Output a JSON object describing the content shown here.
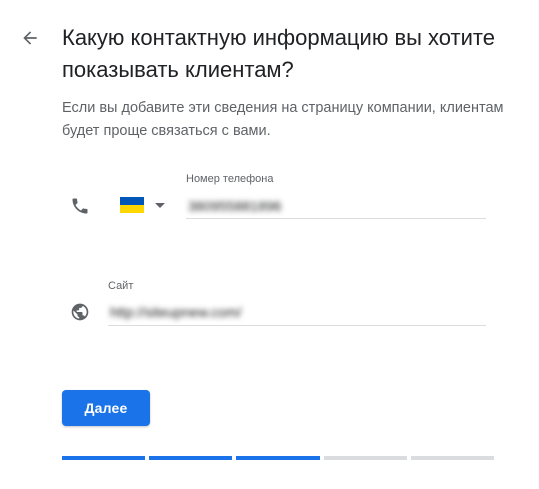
{
  "header": {
    "back_icon": "arrow-left-icon",
    "title": "Какую контактную информацию вы хотите показывать клиентам?",
    "subtitle": "Если вы добавите эти сведения на страницу компании, клиентам будет проще связаться с вами."
  },
  "phone": {
    "icon": "phone-icon",
    "label": "Номер телефона",
    "country_flag": "ukraine-flag",
    "flag_colors": [
      "#0057b7",
      "#ffd700"
    ],
    "value": "380955881896"
  },
  "website": {
    "icon": "globe-icon",
    "label": "Сайт",
    "value": "http://siteupnew.com/"
  },
  "actions": {
    "next_label": "Далее"
  },
  "progress": {
    "total_steps": 5,
    "completed_steps": 3
  },
  "colors": {
    "accent": "#1a73e8",
    "inactive": "#dadce0",
    "text_secondary": "#5f6368"
  }
}
